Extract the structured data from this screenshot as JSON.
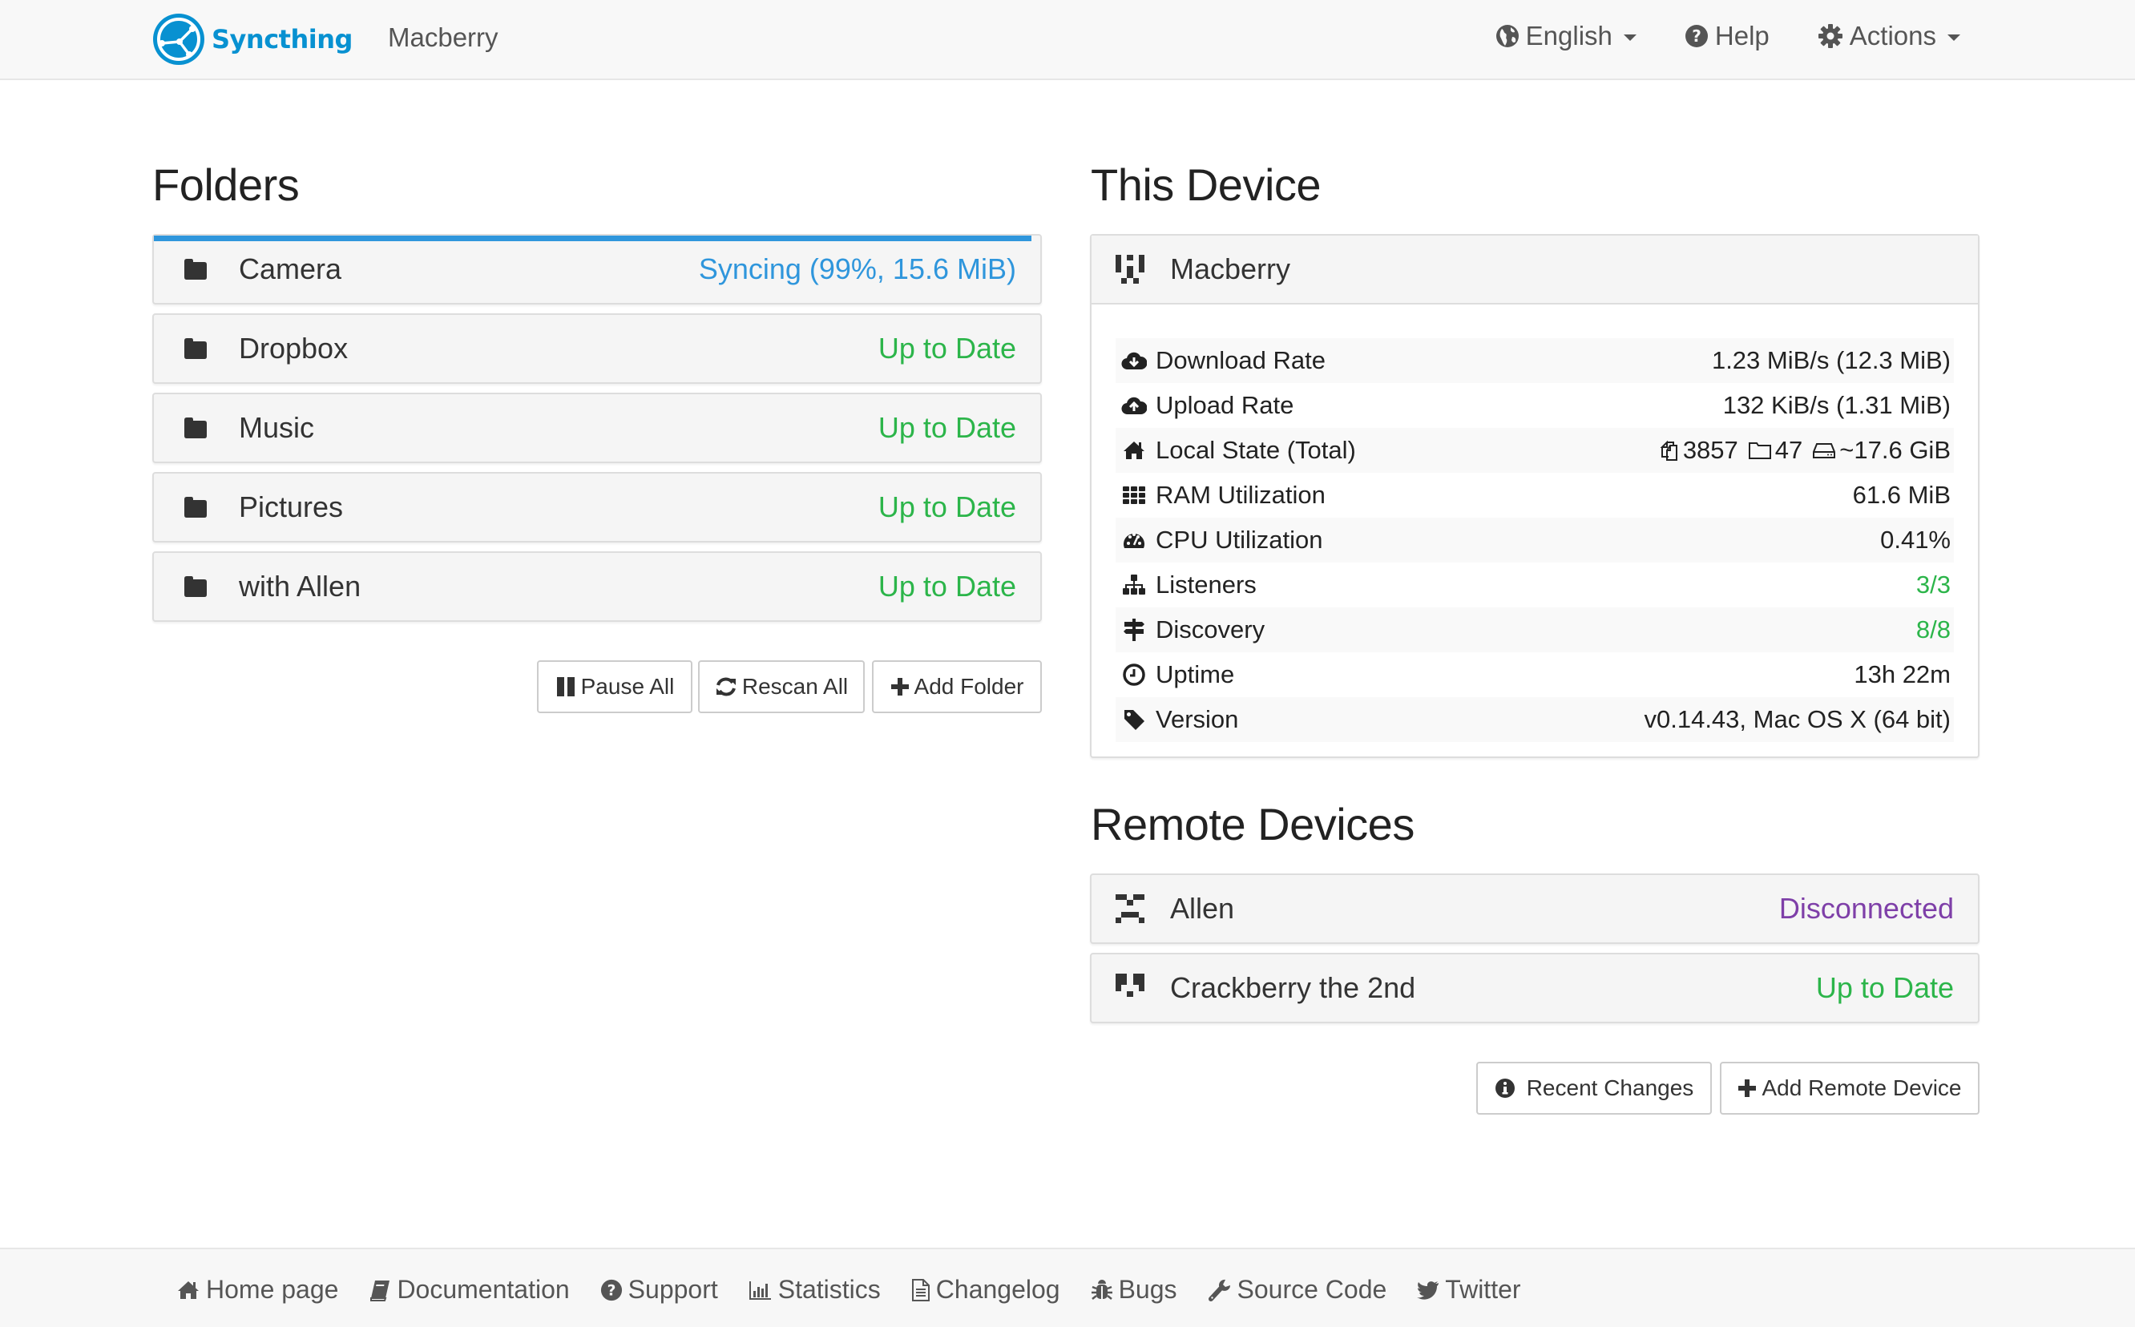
{
  "navbar": {
    "brand": "Syncthing",
    "device_name": "Macberry",
    "items": [
      {
        "label": "English",
        "icon": "globe-icon",
        "dropdown": true
      },
      {
        "label": "Help",
        "icon": "question-circle-icon",
        "dropdown": false
      },
      {
        "label": "Actions",
        "icon": "gear-icon",
        "dropdown": true
      }
    ]
  },
  "folders": {
    "title": "Folders",
    "items": [
      {
        "name": "Camera",
        "status": "Syncing (99%, 15.6 MiB)",
        "state": "syncing",
        "progress": 0.99
      },
      {
        "name": "Dropbox",
        "status": "Up to Date",
        "state": "idle"
      },
      {
        "name": "Music",
        "status": "Up to Date",
        "state": "idle"
      },
      {
        "name": "Pictures",
        "status": "Up to Date",
        "state": "idle"
      },
      {
        "name": "with Allen",
        "status": "Up to Date",
        "state": "idle"
      }
    ],
    "buttons": {
      "pause_all": "Pause All",
      "rescan_all": "Rescan All",
      "add_folder": "Add Folder"
    }
  },
  "this_device": {
    "title": "This Device",
    "name": "Macberry",
    "stats": [
      {
        "label": "Download Rate",
        "icon": "cloud-download-icon",
        "value": "1.23 MiB/s (12.3 MiB)"
      },
      {
        "label": "Upload Rate",
        "icon": "cloud-upload-icon",
        "value": "132 KiB/s (1.31 MiB)"
      },
      {
        "label": "Local State (Total)",
        "icon": "home-icon",
        "files": "3857",
        "directories": "47",
        "size": "~17.6 GiB"
      },
      {
        "label": "RAM Utilization",
        "icon": "th-icon",
        "value": "61.6 MiB"
      },
      {
        "label": "CPU Utilization",
        "icon": "dashboard-icon",
        "value": "0.41%"
      },
      {
        "label": "Listeners",
        "icon": "sitemap-icon",
        "value": "3/3",
        "ok": true
      },
      {
        "label": "Discovery",
        "icon": "signpost-icon",
        "value": "8/8",
        "ok": true
      },
      {
        "label": "Uptime",
        "icon": "clock-icon",
        "value": "13h 22m"
      },
      {
        "label": "Version",
        "icon": "tag-icon",
        "value": "v0.14.43, Mac OS X (64 bit)"
      }
    ]
  },
  "remote_devices": {
    "title": "Remote Devices",
    "items": [
      {
        "name": "Allen",
        "status": "Disconnected",
        "state": "disconnected"
      },
      {
        "name": "Crackberry the 2nd",
        "status": "Up to Date",
        "state": "idle"
      }
    ],
    "buttons": {
      "recent_changes": "Recent Changes",
      "add_remote_device": "Add Remote Device"
    }
  },
  "footer": {
    "links": [
      {
        "label": "Home page",
        "icon": "home-icon"
      },
      {
        "label": "Documentation",
        "icon": "book-icon"
      },
      {
        "label": "Support",
        "icon": "question-circle-icon"
      },
      {
        "label": "Statistics",
        "icon": "bar-chart-icon"
      },
      {
        "label": "Changelog",
        "icon": "file-text-icon"
      },
      {
        "label": "Bugs",
        "icon": "bug-icon"
      },
      {
        "label": "Source Code",
        "icon": "wrench-icon"
      },
      {
        "label": "Twitter",
        "icon": "twitter-icon"
      }
    ]
  },
  "colors": {
    "brand": "#0891d1",
    "up_to_date": "#2cb54a",
    "syncing": "#2f96dc",
    "disconnected": "#7e3fa8"
  }
}
